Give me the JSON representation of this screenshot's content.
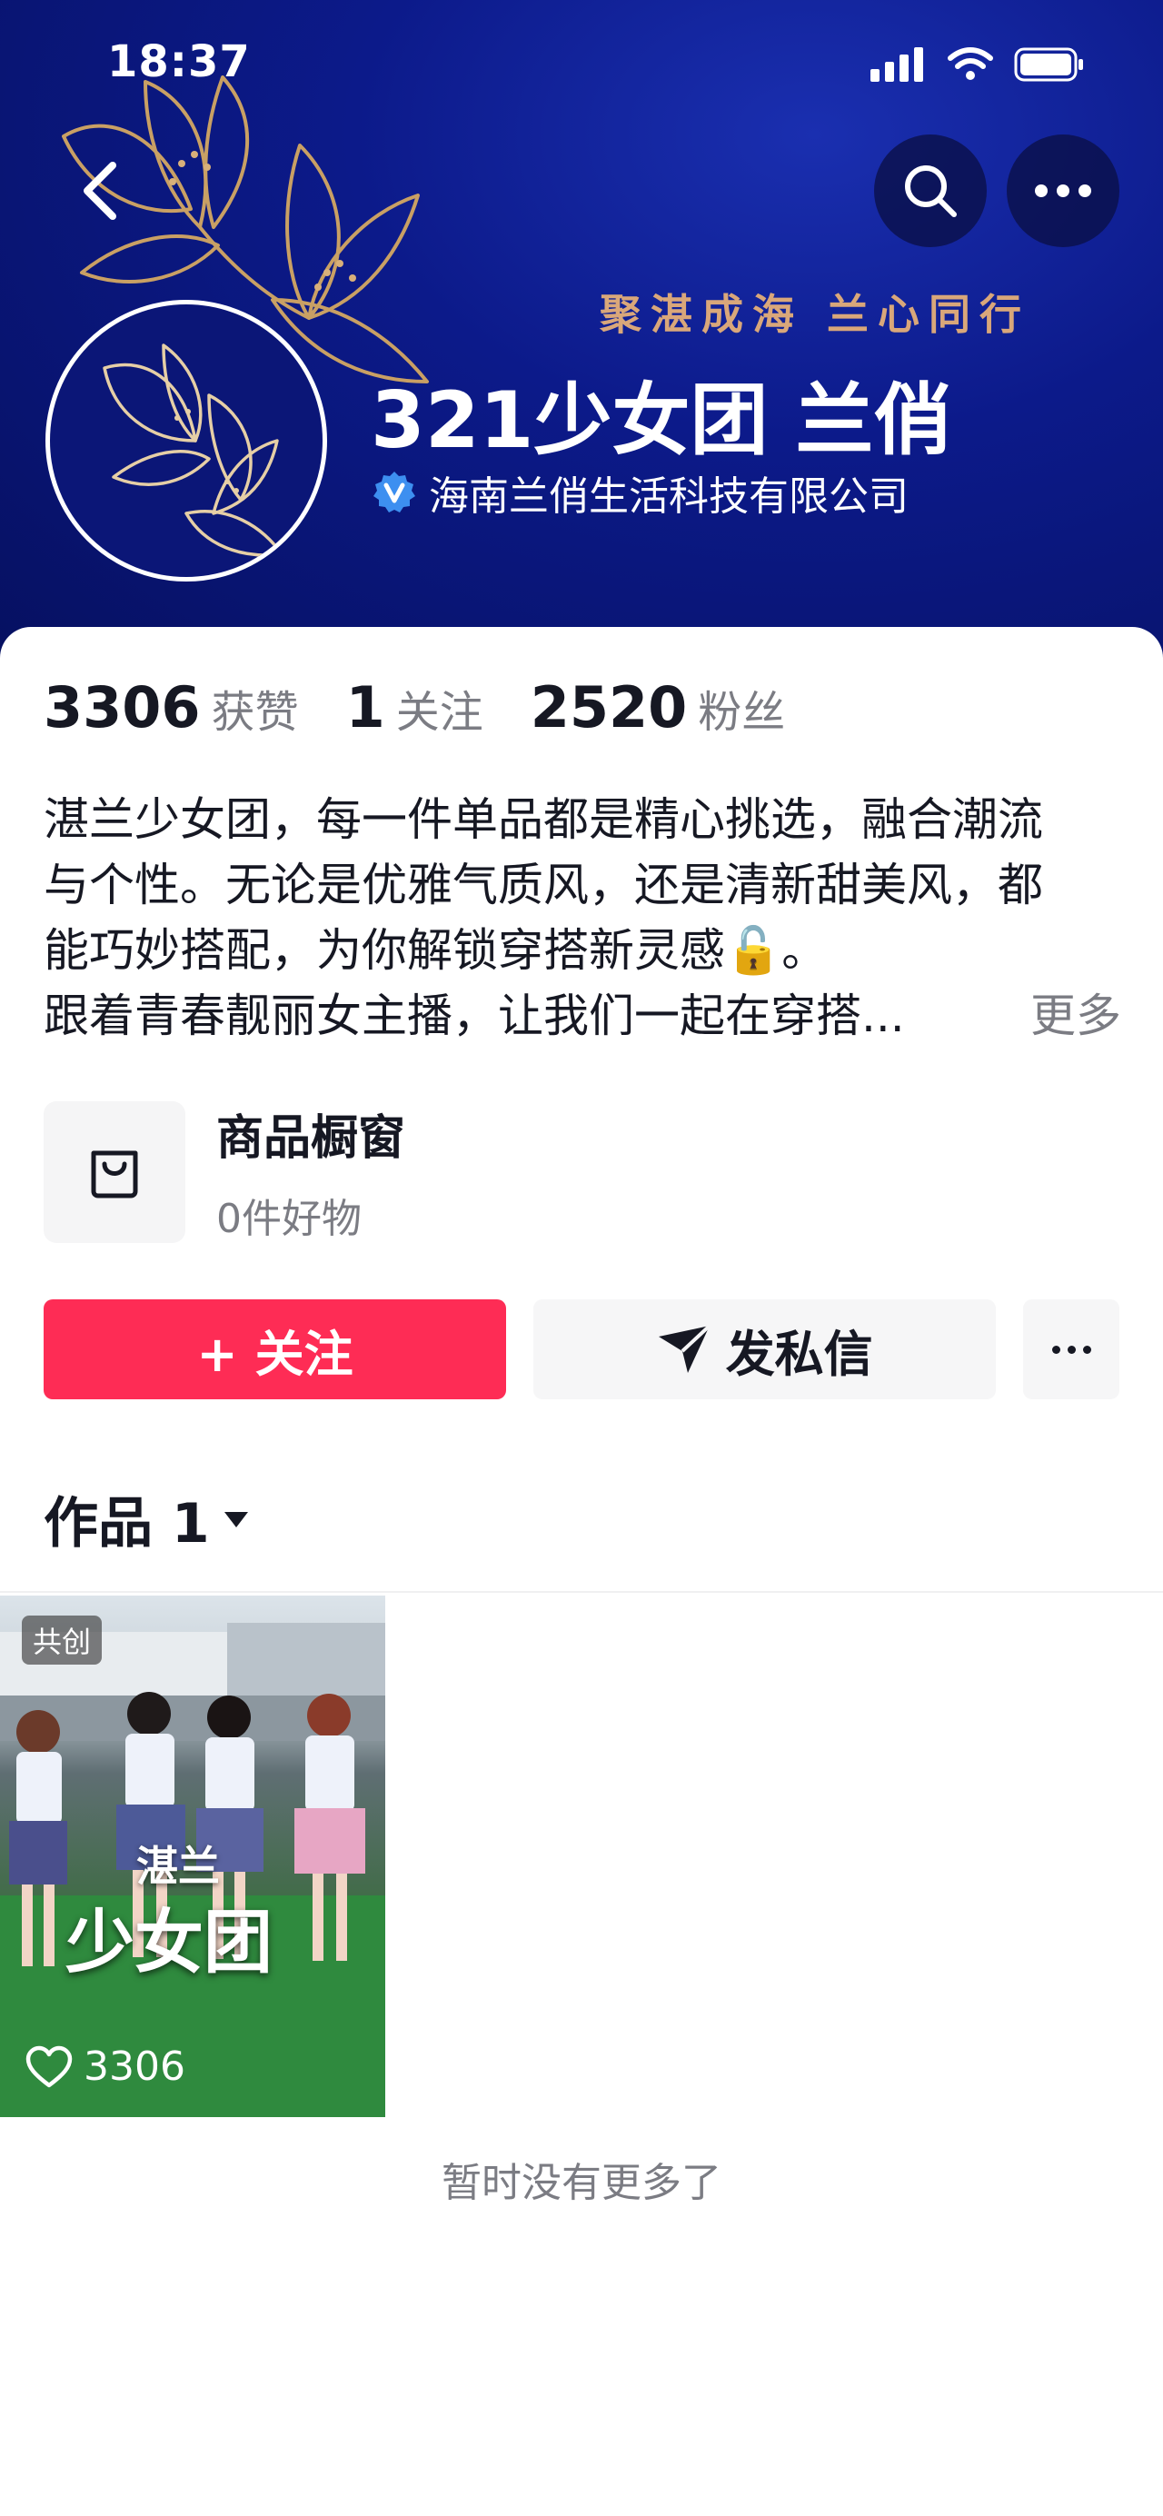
{
  "status_bar": {
    "time": "18:37"
  },
  "header": {
    "slogan": "聚湛成海  兰心同行",
    "name": "321少女团 兰俏",
    "verified_org": "海南兰俏生活科技有限公司"
  },
  "stats": [
    {
      "value": "3306",
      "label": "获赞"
    },
    {
      "value": "1",
      "label": "关注"
    },
    {
      "value": "2520",
      "label": "粉丝"
    }
  ],
  "bio": {
    "lines": [
      "湛兰少女团，每一件单品都是精心挑选，融合潮流",
      "与个性。无论是优雅气质风，还是清新甜美风，都",
      "能巧妙搭配，为你解锁穿搭新灵感🔓。",
      "跟着青春靓丽女主播，让我们一起在穿搭..."
    ],
    "more": "更多"
  },
  "shop": {
    "title": "商品橱窗",
    "subtitle": "0件好物"
  },
  "actions": {
    "follow": "+ 关注",
    "message": "发私信"
  },
  "tabs": {
    "works_label": "作品 1"
  },
  "videos": [
    {
      "tag": "共创",
      "likes": "3306",
      "overlay_small": "湛兰",
      "overlay_big": "少女团"
    }
  ],
  "footer": {
    "end_text": "暂时没有更多了"
  },
  "colors": {
    "accent": "#fe2c55",
    "banner": "#0c1a8a",
    "slogan": "#d9a77a"
  }
}
